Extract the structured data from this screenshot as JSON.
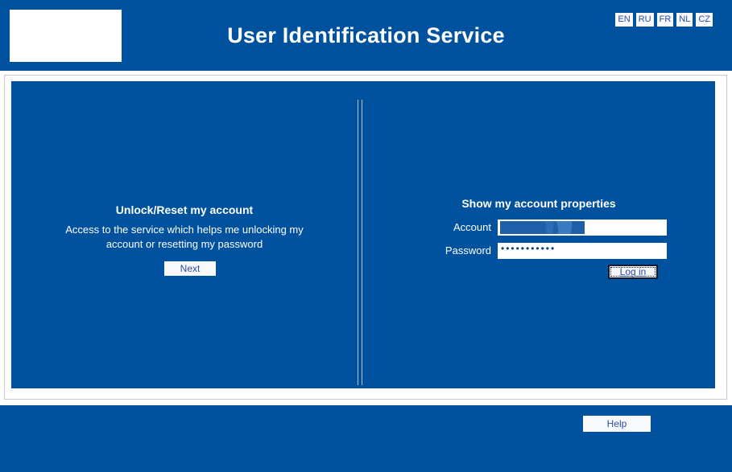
{
  "header": {
    "title": "User Identification Service",
    "logo_alt": "",
    "languages": [
      {
        "code": "EN"
      },
      {
        "code": "RU"
      },
      {
        "code": "FR"
      },
      {
        "code": "NL"
      },
      {
        "code": "CZ"
      }
    ]
  },
  "left_panel": {
    "heading": "Unlock/Reset my account",
    "description": "Access to the service which helps me unlocking my account or resetting my password",
    "next_label": "Next"
  },
  "right_panel": {
    "heading": "Show my account properties",
    "account_label": "Account",
    "account_value": "",
    "account_placeholder": "",
    "password_label": "Password",
    "password_value": "•••••••••••",
    "password_placeholder": "",
    "login_label": "Log in"
  },
  "footer": {
    "help_label": "Help"
  },
  "colors": {
    "brand_blue": "#00519e",
    "button_face": "#f7f9fc",
    "link_blue": "#2b4ba8",
    "frame_border": "#c9c9c9",
    "divider": "#b9c2d6"
  }
}
